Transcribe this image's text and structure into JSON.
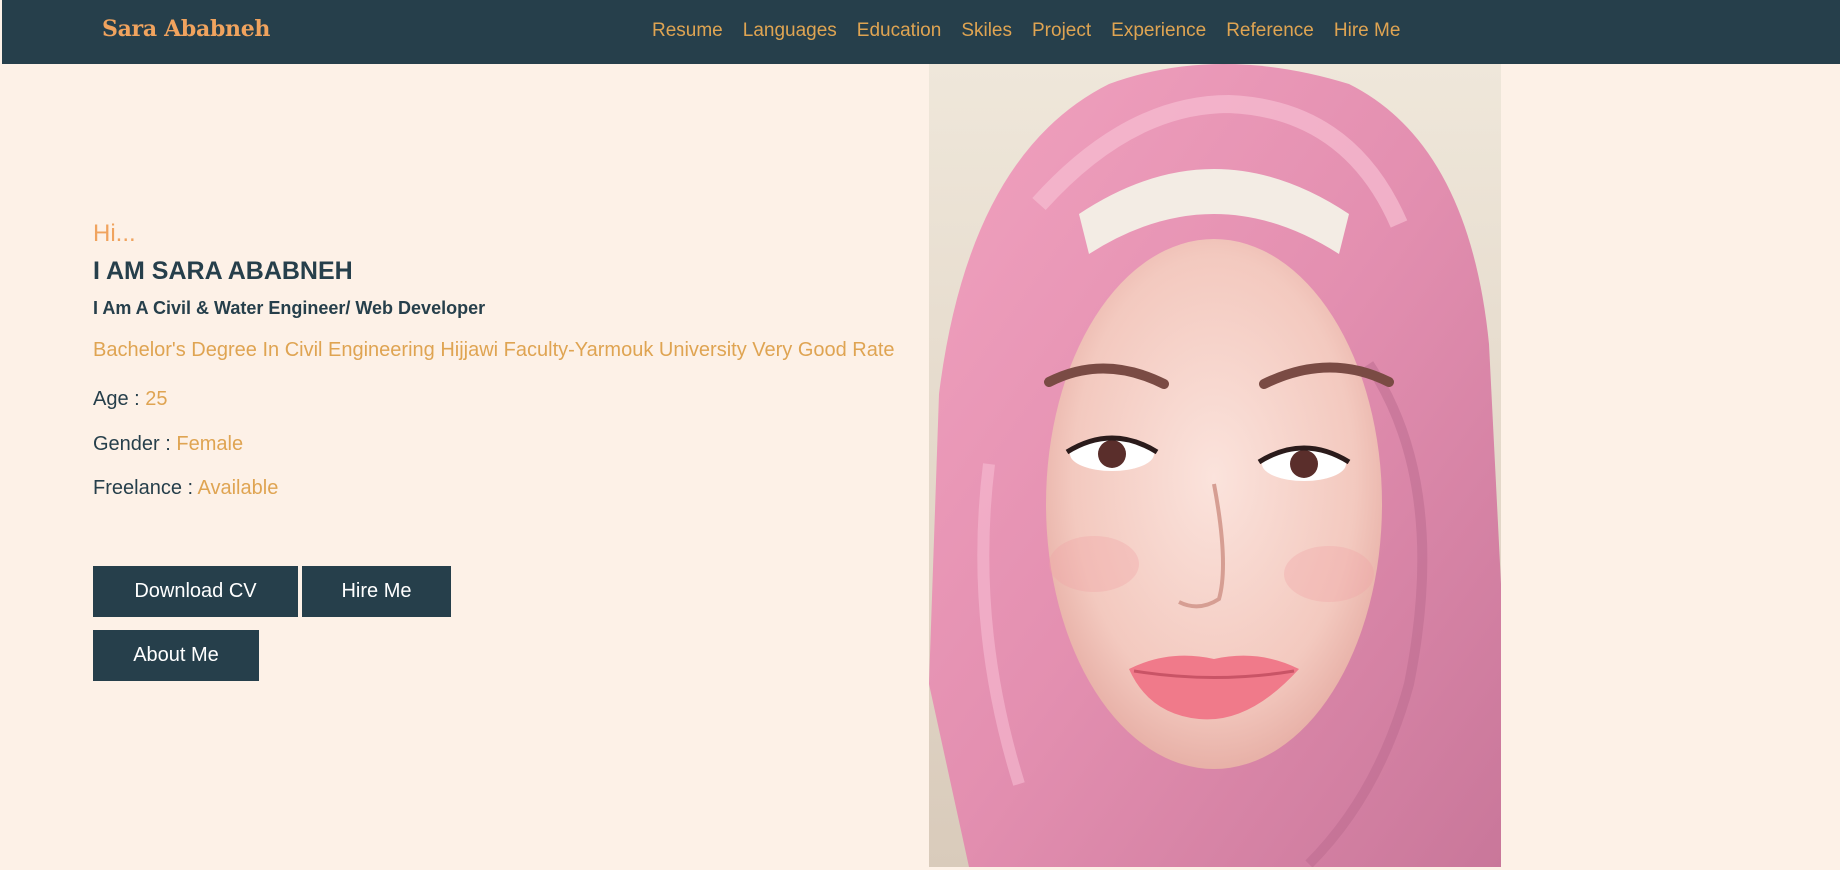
{
  "navbar": {
    "brand": "Sara Ababneh",
    "links": [
      "Resume",
      "Languages",
      "Education",
      "Skiles",
      "Project",
      "Experience",
      "Reference",
      "Hire Me"
    ]
  },
  "hero": {
    "greeting": "Hi...",
    "name": "I AM SARA ABABNEH",
    "tagline": "I Am A Civil & Water Engineer/ Web Developer",
    "degree": "Bachelor's Degree In Civil Engineering Hijjawi Faculty-Yarmouk University Very Good Rate",
    "age_label": "Age : ",
    "age_value": "25",
    "gender_label": "Gender : ",
    "gender_value": "Female",
    "freelance_label": "Freelance : ",
    "freelance_value": "Available"
  },
  "buttons": {
    "download_cv": "Download CV",
    "hire_me": "Hire Me",
    "about_me": "About Me"
  },
  "colors": {
    "navbar_bg": "#263f4b",
    "page_bg": "#fdf1e7",
    "accent_orange": "#f0a35e",
    "accent_gold": "#dfa452",
    "dark_text": "#263f4b"
  }
}
